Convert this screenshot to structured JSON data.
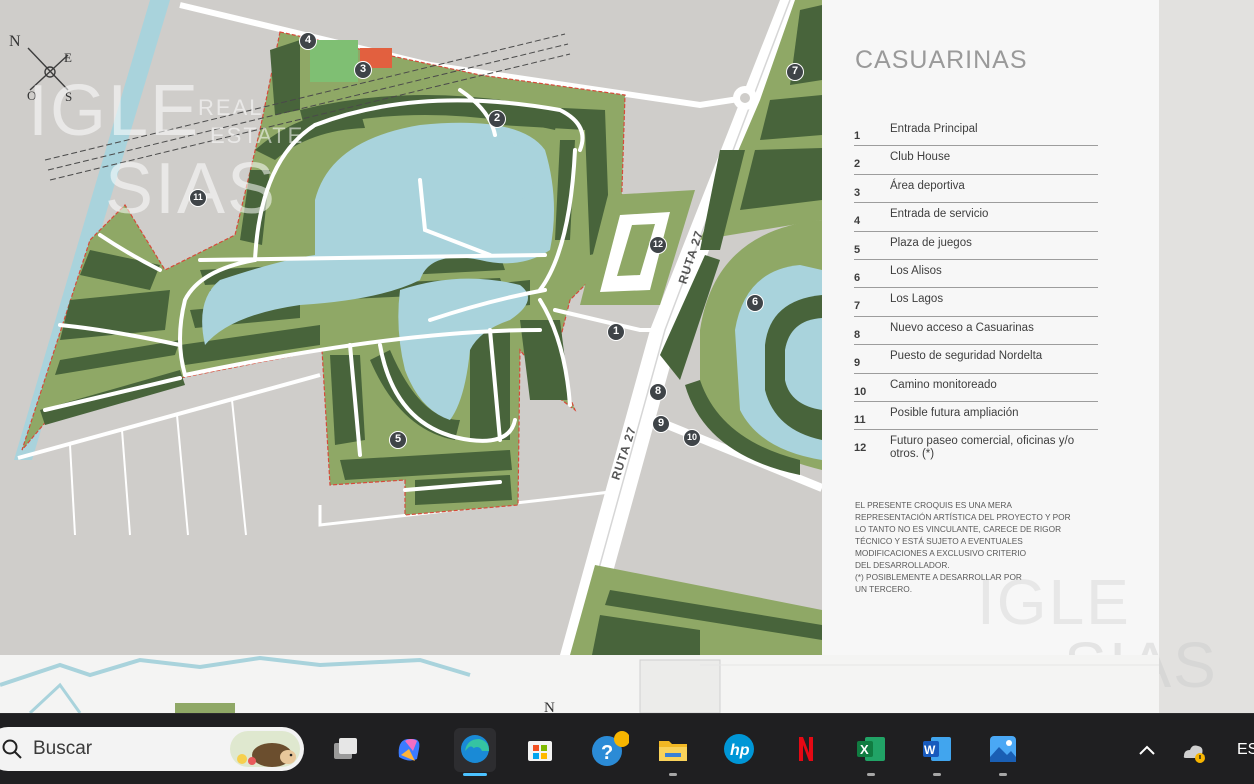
{
  "legend": {
    "title": "CASUARINAS",
    "items": [
      {
        "num": "1",
        "label": "Entrada Principal"
      },
      {
        "num": "2",
        "label": "Club House"
      },
      {
        "num": "3",
        "label": "Área deportiva"
      },
      {
        "num": "4",
        "label": "Entrada de servicio"
      },
      {
        "num": "5",
        "label": "Plaza de juegos"
      },
      {
        "num": "6",
        "label": "Los Alisos"
      },
      {
        "num": "7",
        "label": "Los Lagos"
      },
      {
        "num": "8",
        "label": "Nuevo acceso a Casuarinas"
      },
      {
        "num": "9",
        "label": "Puesto de seguridad Nordelta"
      },
      {
        "num": "10",
        "label": "Camino monitoreado"
      },
      {
        "num": "11",
        "label": "Posible futura ampliación"
      },
      {
        "num": "12",
        "label": "Futuro paseo comercial, oficinas y/o otros. (*)"
      }
    ],
    "note_lines": [
      "EL PRESENTE CROQUIS ES UNA MERA",
      "REPRESENTACIÓN ARTÍSTICA DEL PROYECTO Y POR",
      "LO TANTO NO ES VINCULANTE, CARECE DE RIGOR",
      "TÉCNICO Y ESTÁ SUJETO A EVENTUALES",
      "MODIFICACIONES A EXCLUSIVO CRITERIO",
      "DEL DESARROLLADOR.",
      "(*) POSIBLEMENTE A DESARROLLAR POR",
      "UN TERCERO."
    ]
  },
  "map": {
    "compass": {
      "n": "N",
      "e": "E",
      "s": "S",
      "o": "O"
    },
    "road_labels": {
      "ruta_upper": "RUTA 27",
      "ruta_lower": "RUTA 27"
    },
    "markers": [
      "1",
      "2",
      "3",
      "4",
      "5",
      "6",
      "7",
      "8",
      "9",
      "10",
      "11",
      "12"
    ],
    "watermark_top": "IGLE",
    "watermark_bottom": "SIAS",
    "watermark_small_1": "REAL",
    "watermark_small_2": "ESTATE",
    "next_page_compass": "N",
    "colors": {
      "lot_green": "#48643b",
      "park_green": "#8fa866",
      "lake": "#a9d3dc",
      "road": "#ffffff",
      "land": "#cfcdca",
      "border": "#d64a3a",
      "marker": "#3f4448"
    }
  },
  "taskbar": {
    "search_placeholder": "Buscar",
    "language": "ES",
    "apps": [
      "task-view",
      "copilot",
      "edge",
      "store",
      "help",
      "file-explorer",
      "hp",
      "netflix",
      "excel",
      "word",
      "photos"
    ]
  }
}
